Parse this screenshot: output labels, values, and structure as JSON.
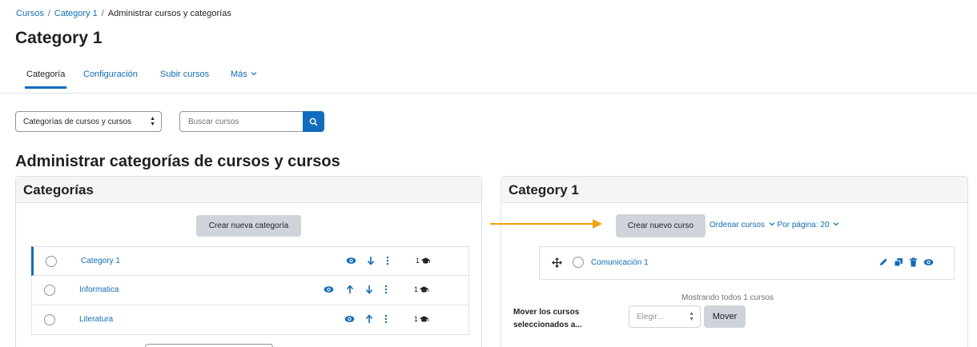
{
  "breadcrumb": {
    "items": [
      "Cursos",
      "Category 1",
      "Administrar cursos y categorías"
    ],
    "separator": "/"
  },
  "page": {
    "title": "Category 1",
    "heading": "Administrar categorías de cursos y cursos"
  },
  "secondary_nav": {
    "tabs": [
      {
        "label": "Categoría",
        "active": true
      },
      {
        "label": "Configuración",
        "active": false
      },
      {
        "label": "Subir cursos",
        "active": false
      },
      {
        "label": "Más",
        "active": false
      }
    ]
  },
  "view_select": {
    "value": "Categorías de cursos y cursos"
  },
  "search": {
    "placeholder": "Buscar cursos"
  },
  "categories_panel": {
    "title": "Categorías",
    "create_button": "Crear nueva categoría",
    "rows": [
      {
        "name": "Category 1",
        "count": "1",
        "selected": true
      },
      {
        "name": "Informatica",
        "count": "1",
        "selected": false
      },
      {
        "name": "Literatura",
        "count": "1",
        "selected": false
      }
    ]
  },
  "courses_panel": {
    "title": "Category 1",
    "create_button": "Crear nuevo curso",
    "sort_link": "Ordenar cursos",
    "per_page_link": "Por página: 20",
    "course": {
      "name": "Comunicación 1"
    },
    "showing_text": "Mostrando todos 1 cursos",
    "move_label": "Mover los cursos seleccionados a...",
    "move_select": "Elegir...",
    "move_button": "Mover"
  },
  "colors": {
    "link": "#0f6cbf",
    "accent_arrow": "#f0a30a",
    "button_secondary": "#ced4da"
  },
  "icons": [
    "eye-icon",
    "arrow-down-icon",
    "arrow-up-icon",
    "kebab-menu-icon",
    "graduation-cap-icon",
    "move-icon",
    "pencil-icon",
    "copy-icon",
    "trash-icon",
    "search-icon",
    "chevron-down-icon"
  ]
}
